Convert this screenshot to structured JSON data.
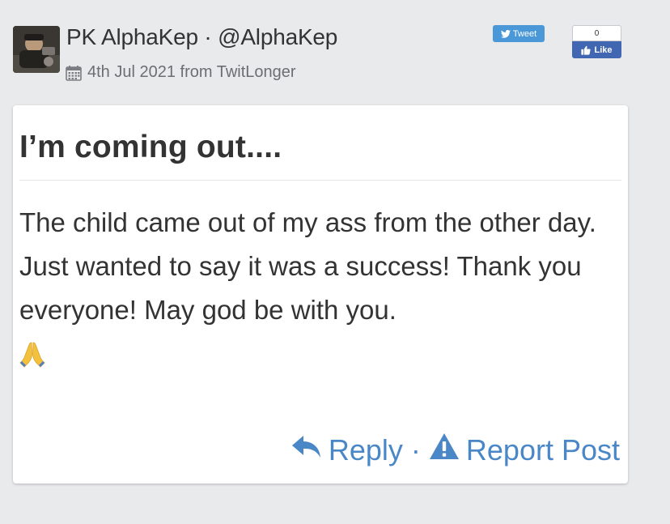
{
  "author": {
    "display": "PK AlphaKep · @AlphaKep"
  },
  "meta": {
    "date_source": "4th Jul 2021 from TwitLonger"
  },
  "share": {
    "tweet_label": "Tweet",
    "like_count": "0",
    "like_label": "Like"
  },
  "post": {
    "title": "I’m coming out....",
    "body": "The child came out of my ass from the other day. Just wanted to say it was a success! Thank you everyone! May god be with you."
  },
  "actions": {
    "reply_label": "Reply",
    "separator": "·",
    "report_label": "Report Post"
  },
  "icons": {
    "calendar": "calendar-icon",
    "twitter_bird": "twitter-bird-icon",
    "thumbs_up": "thumbs-up-icon",
    "reply": "reply-arrow-icon",
    "warning": "warning-icon",
    "emoji": "folded-hands-emoji"
  },
  "colors": {
    "background": "#e9eaec",
    "link": "#4a87c7",
    "tweet_button": "#4a98d8",
    "like_button": "#4267b2"
  }
}
